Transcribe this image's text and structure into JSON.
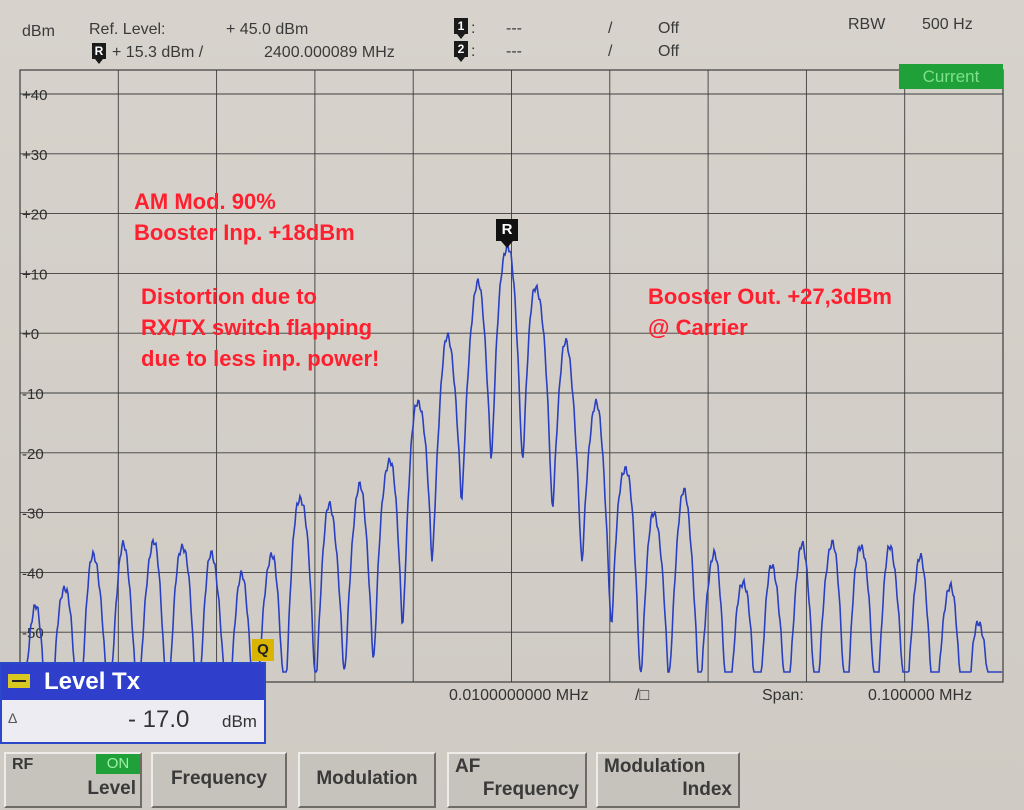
{
  "header": {
    "unit": "dBm",
    "ref_level_label": "Ref. Level:",
    "ref_level_value": "+ 45.0  dBm",
    "marker_r_icon": "R",
    "marker_r_value": "+ 15.3  dBm  /",
    "marker_r_freq": "2400.000089  MHz",
    "marker1_icon": "1",
    "marker1_colon": ":",
    "marker1_dashes": "---",
    "marker1_slash": "/",
    "marker1_state": "Off",
    "marker2_icon": "2",
    "marker2_colon": ":",
    "marker2_dashes": "---",
    "marker2_slash": "/",
    "marker2_state": "Off",
    "rbw_label": "RBW",
    "rbw_value": "500 Hz"
  },
  "status_badge": "Current",
  "y_ticks": [
    "+40",
    "+30",
    "+20",
    "+10",
    "+0",
    "-10",
    "-20",
    "-30",
    "-40",
    "-50"
  ],
  "annotations": {
    "left_top": [
      "AM Mod. 90%",
      "Booster Inp. +18dBm"
    ],
    "left_mid": [
      "Distortion due to",
      "RX/TX switch flapping",
      "due to less inp. power!"
    ],
    "right": [
      "Booster Out. +27,3dBm",
      "@ Carrier"
    ]
  },
  "markers": {
    "ref": "R",
    "q": "Q"
  },
  "footer": {
    "center_freq": "0.0100000000 MHz",
    "div_symbol": "/□",
    "span_label": "Span:",
    "span_value": "0.100000  MHz"
  },
  "level_tx": {
    "title": "Level Tx",
    "delta": "Δ",
    "value": "- 17.0",
    "unit": "dBm"
  },
  "softkeys": {
    "rf": "RF",
    "rf_state": "ON",
    "rf_level": "Level",
    "frequency": "Frequency",
    "modulation": "Modulation",
    "af_top": "AF",
    "af_bottom": "Frequency",
    "mi_top": "Modulation",
    "mi_bottom": "Index"
  },
  "chart_data": {
    "type": "line",
    "ylim": [
      -60,
      45
    ],
    "yunit": "dBm",
    "grid": true,
    "peak_offsets": [
      -16,
      -15,
      -14,
      -13,
      -12,
      -11,
      -10,
      -9,
      -8,
      -7,
      -6,
      -5,
      -4,
      -3,
      -2,
      -1,
      0,
      1,
      2,
      3,
      4,
      5,
      6,
      7,
      8,
      9,
      10,
      11,
      12,
      13,
      14,
      15,
      16
    ],
    "peak_levels": [
      -46,
      -42,
      -37,
      -36,
      -35,
      -35,
      -37,
      -41,
      -37,
      -27,
      -29,
      -26,
      -21,
      -11,
      -1,
      8,
      15,
      8,
      -2,
      -12,
      -22,
      -30,
      -27,
      -37,
      -41,
      -39,
      -36,
      -35,
      -35,
      -36,
      -38,
      -42,
      -48
    ],
    "series_color": "#2a40c0"
  },
  "colors": {
    "annotation": "#ff1f2e",
    "trace": "#2a40c0",
    "badge": "#1fa038",
    "dialog": "#2f3fcc"
  }
}
